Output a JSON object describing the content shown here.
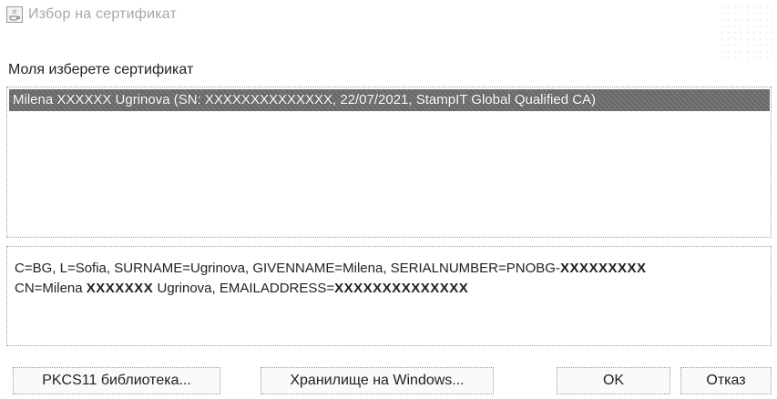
{
  "window": {
    "title": "Избор на сертификат",
    "icon": "java-cup-icon"
  },
  "prompt": "Моля изберете сертификат",
  "certificates": [
    {
      "label": "Milena XXXXXX Ugrinova (SN: XXXXXXXXXXXXXX, 22/07/2021, StampIT Global Qualified CA)",
      "selected": true
    }
  ],
  "details": {
    "line1_prefix": "C=BG, L=Sofia, SURNAME=Ugrinova, GIVENNAME=Milena, SERIALNUMBER=PNOBG-",
    "line1_masked": "XXXXXXXXX",
    "line2_prefix": "CN=Milena ",
    "line2_masked": "XXXXXXX",
    "line2_middle": " Ugrinova, EMAILADDRESS=",
    "line2_masked2": "XXXXXXXXXXXXXX"
  },
  "buttons": {
    "pkcs": "PKCS11 библиотека...",
    "windows_store": "Хранилище на Windows...",
    "ok": "OK",
    "cancel": "Отказ"
  },
  "colors": {
    "selection": "#6e6e6e",
    "title_text": "#a8a8a8"
  }
}
